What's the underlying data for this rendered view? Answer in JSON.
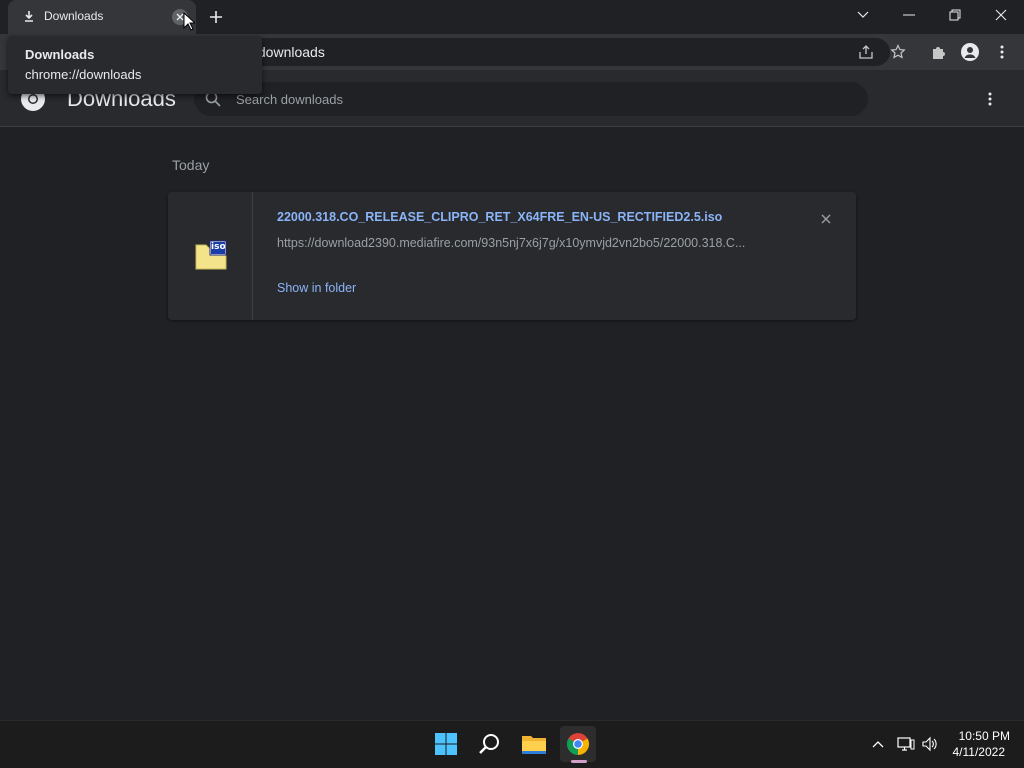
{
  "tab": {
    "title": "Downloads"
  },
  "tooltip": {
    "title": "Downloads",
    "url": "chrome://downloads"
  },
  "omnibox": {
    "text": "/downloads"
  },
  "page": {
    "title": "Downloads",
    "search_placeholder": "Search downloads"
  },
  "section": {
    "label": "Today"
  },
  "download": {
    "file_name": "22000.318.CO_RELEASE_CLIPRO_RET_X64FRE_EN-US_RECTIFIED2.5.iso",
    "url": "https://download2390.mediafire.com/93n5nj7x6j7g/x10ymvjd2vn2bo5/22000.318.C...",
    "show_in_folder": "Show in folder",
    "icon_label": "iso"
  },
  "taskbar": {
    "time": "10:50 PM",
    "date": "4/11/2022"
  },
  "colors": {
    "accent_link": "#8ab4f8",
    "background": "#202124",
    "surface": "#292a2d"
  }
}
